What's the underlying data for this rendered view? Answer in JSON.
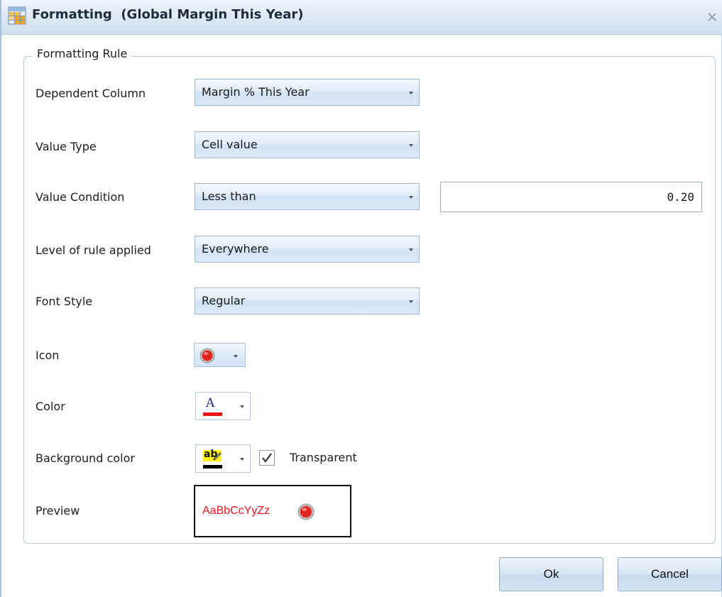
{
  "window": {
    "title": "Formatting  (Global Margin This Year)",
    "app_icon": "table-format-icon",
    "close_icon": "close-icon"
  },
  "group": {
    "legend": "Formatting Rule"
  },
  "fields": {
    "dependent_column": {
      "label": "Dependent Column",
      "value": "Margin % This Year"
    },
    "value_type": {
      "label": "Value Type",
      "value": "Cell value"
    },
    "value_condition": {
      "label": "Value Condition",
      "value": "Less than",
      "input_value": "0.20"
    },
    "level": {
      "label": "Level of rule applied",
      "value": "Everywhere"
    },
    "font_style": {
      "label": "Font Style",
      "value": "Regular"
    },
    "icon": {
      "label": "Icon",
      "icon_name": "red-circle-icon"
    },
    "color": {
      "label": "Color",
      "glyph": "A",
      "underline_color": "#e8161b"
    },
    "background": {
      "label": "Background color",
      "glyph": "ab",
      "checkbox_label": "Transparent",
      "checked": true
    },
    "preview": {
      "label": "Preview",
      "sample_text": "AaBbCcYyZz",
      "text_color": "#e8161b"
    }
  },
  "buttons": {
    "ok": "Ok",
    "cancel": "Cancel"
  },
  "colors": {
    "accent": "#d3e3f5",
    "border": "#9fb7d4",
    "red": "#e8161b"
  }
}
